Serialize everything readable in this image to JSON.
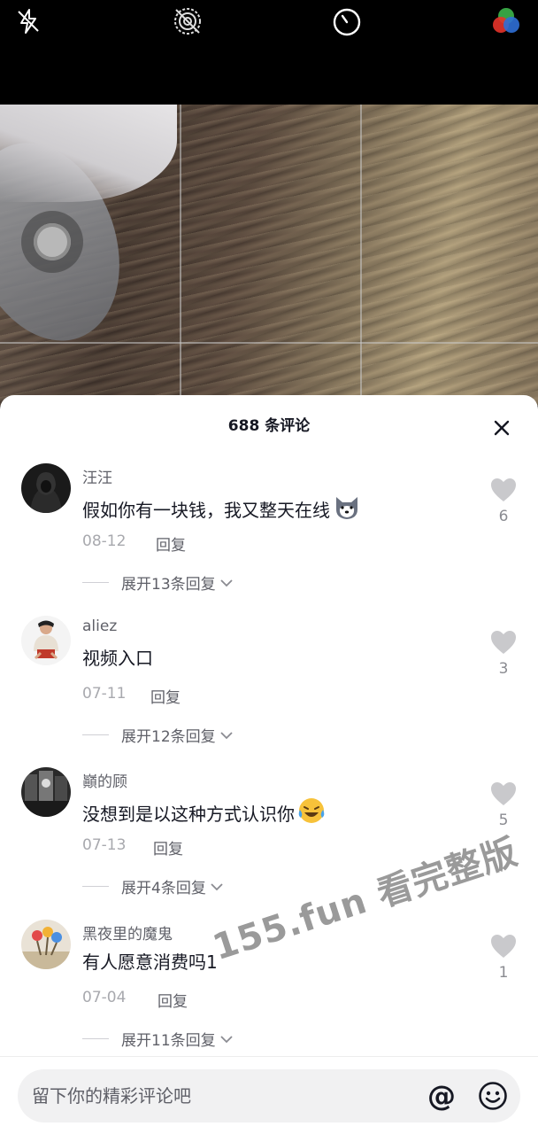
{
  "camera_toolbar": {
    "icons": [
      "flash-off-icon",
      "live-off-icon",
      "timer-icon",
      "filter-icon"
    ]
  },
  "comments_panel": {
    "title": "688 条评论",
    "close_icon": "close-icon",
    "comments": [
      {
        "username": "汪汪",
        "text": "假如你有一块钱，我又整天在线",
        "emoji": "husky-emoji",
        "date": "08-12",
        "reply_label": "回复",
        "expand_label": "展开13条回复",
        "likes": "6"
      },
      {
        "username": "aliez",
        "text": "视频入口",
        "emoji": "",
        "date": "07-11",
        "reply_label": "回复",
        "expand_label": "展开12条回复",
        "likes": "3"
      },
      {
        "username": "巓的顾",
        "text": "没想到是以这种方式认识你",
        "emoji": "laughing-crying-emoji",
        "date": "07-13",
        "reply_label": "回复",
        "expand_label": "展开4条回复",
        "likes": "5"
      },
      {
        "username": "黑夜里的魔鬼",
        "text": "有人愿意消费吗1",
        "emoji": "",
        "date": "07-04",
        "reply_label": "回复",
        "expand_label": "展开11条回复",
        "likes": "1"
      }
    ]
  },
  "watermark": "155.fun 看完整版",
  "input": {
    "placeholder": "留下你的精彩评论吧",
    "value": "",
    "mention_label": "@"
  },
  "colors": {
    "primary_text": "#161823",
    "secondary_text": "#5f6068",
    "muted_text": "#a8a9ae",
    "like_icon": "#c9c9cc",
    "sheet_bg": "#ffffff"
  }
}
